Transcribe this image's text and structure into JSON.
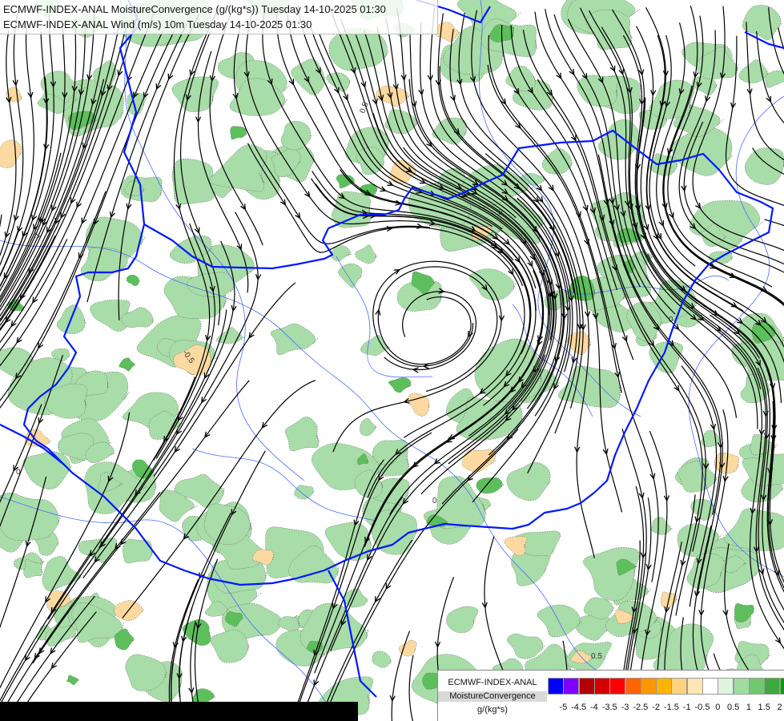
{
  "header": {
    "title_line1": "ECMWF-INDEX-ANAL MoistureConvergence (g/(kg*s)) Tuesday 14-10-2025 01:30",
    "title_line2": "ECMWF-INDEX-ANAL Wind (m/s) 10m Tuesday 14-10-2025 01:30"
  },
  "legend": {
    "title_line1": "ECMWF-INDEX-ANAL",
    "title_line2": "MoistureConvergence",
    "units": "g/(kg*s)",
    "colors": [
      "#0000ff",
      "#8000ff",
      "#b30000",
      "#d20000",
      "#ff0000",
      "#ff6400",
      "#ff9600",
      "#ffb400",
      "#ffd27d",
      "#ffe6b4",
      "#ffffff",
      "#dcf5dc",
      "#a0dca0",
      "#6ec86e",
      "#3caa3c",
      "#00a000"
    ],
    "tick_labels": [
      "-5",
      "-4.5",
      "-4",
      "-3.5",
      "-3",
      "-2.5",
      "-2",
      "-1.5",
      "-1",
      "-0.5",
      "0",
      "0.5",
      "1",
      "1.5",
      "2"
    ]
  },
  "contour_labels": [
    "0",
    "0.5",
    "-0.5",
    "-1"
  ],
  "colors": {
    "border_line": "#0019ff",
    "river_line": "#4b6bff",
    "streamline": "#000000",
    "positive_fill": "#a8dca8",
    "strong_positive_fill": "#5cbf5c",
    "negative_fill": "#fcd9a0"
  }
}
